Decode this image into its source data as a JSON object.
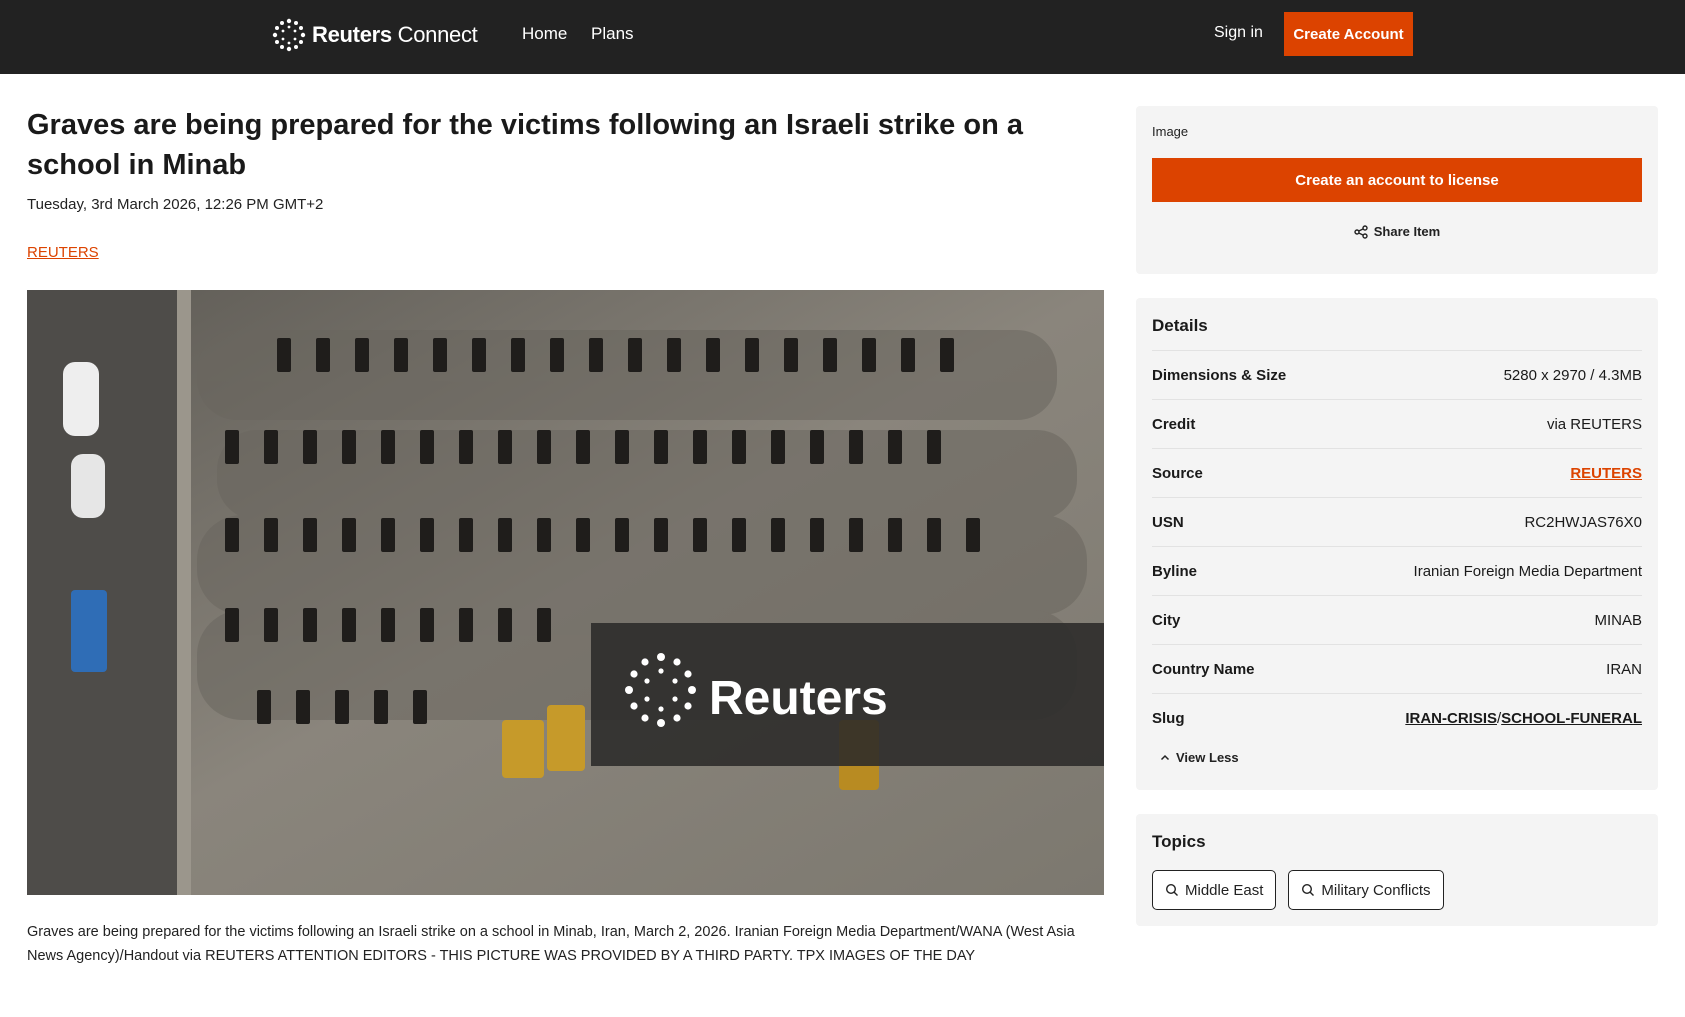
{
  "header": {
    "logo_bold": "Reuters",
    "logo_light": "Connect",
    "nav": [
      {
        "label": "Home"
      },
      {
        "label": "Plans"
      }
    ],
    "signin_label": "Sign in",
    "create_account_label": "Create Account"
  },
  "article": {
    "title": "Graves are being prepared for the victims following an Israeli strike on a school in Minab",
    "date": "Tuesday, 3rd March 2026, 12:26 PM GMT+2",
    "provider": "REUTERS",
    "watermark": "Reuters",
    "caption": "Graves are being prepared for the victims following an Israeli strike on a school in Minab, Iran, March 2, 2026. Iranian Foreign Media Department/WANA (West Asia News Agency)/Handout via REUTERS ATTENTION EDITORS - THIS PICTURE WAS PROVIDED BY A THIRD PARTY. TPX IMAGES OF THE DAY"
  },
  "license_panel": {
    "type_label": "Image",
    "license_button": "Create an account to license",
    "share_label": "Share Item"
  },
  "details": {
    "title": "Details",
    "rows": [
      {
        "key": "Dimensions & Size",
        "value": "5280 x 2970 / 4.3MB"
      },
      {
        "key": "Credit",
        "value": "via REUTERS"
      },
      {
        "key": "Source",
        "value": "REUTERS"
      },
      {
        "key": "USN",
        "value": "RC2HWJAS76X0"
      },
      {
        "key": "Byline",
        "value": "Iranian Foreign Media Department"
      },
      {
        "key": "City",
        "value": "MINAB"
      },
      {
        "key": "Country Name",
        "value": "IRAN"
      }
    ],
    "slug_key": "Slug",
    "slug_part1": "IRAN-CRISIS",
    "slug_sep": "/",
    "slug_part2": "SCHOOL-FUNERAL",
    "view_less": "View Less"
  },
  "topics": {
    "title": "Topics",
    "items": [
      {
        "label": "Middle East"
      },
      {
        "label": "Military Conflicts"
      }
    ]
  },
  "colors": {
    "accent": "#dc4300",
    "header_bg": "#222222",
    "panel_bg": "#f4f4f4"
  },
  "icons": [
    "reuters-logo-icon",
    "share-icon",
    "chevron-up-icon",
    "search-icon"
  ]
}
